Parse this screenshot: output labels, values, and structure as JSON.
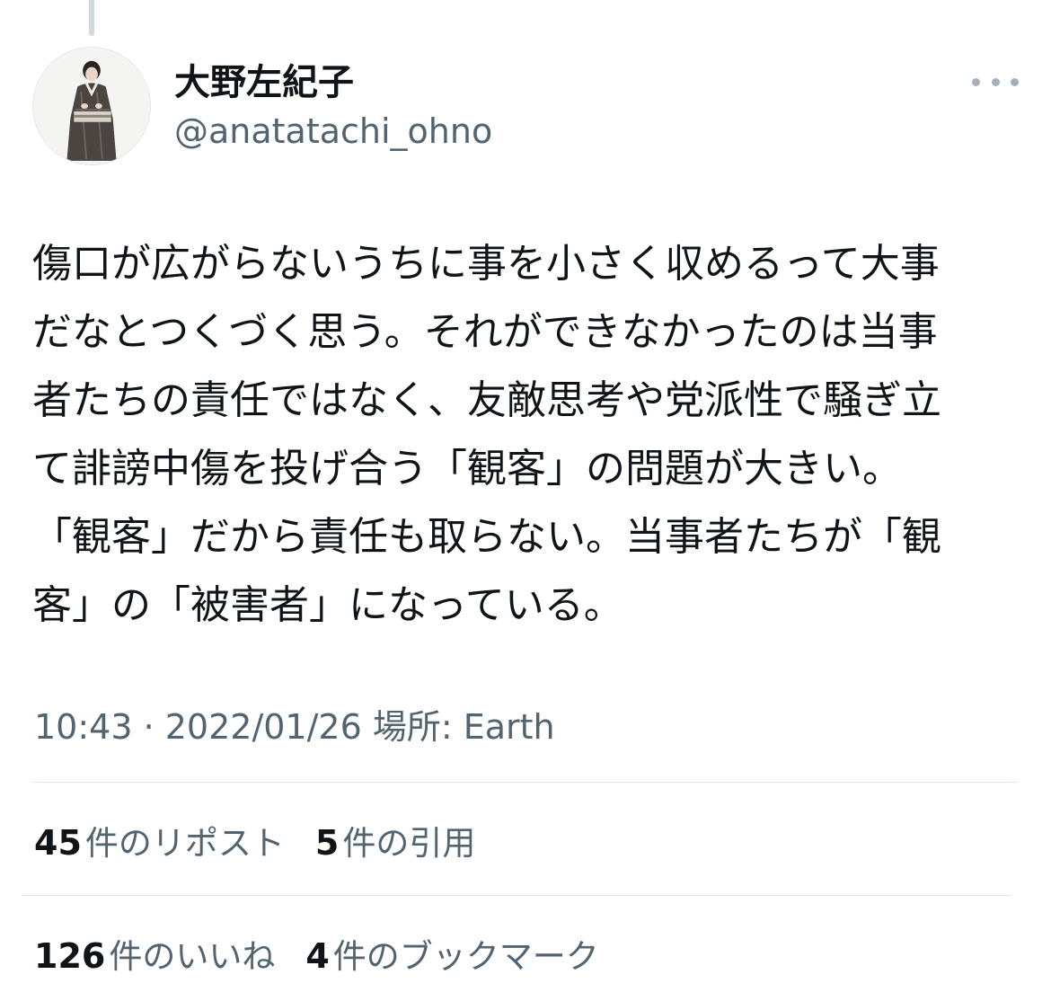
{
  "author": {
    "display_name": "大野左紀子",
    "handle": "@anatatachi_ohno"
  },
  "tweet": {
    "lines": [
      "傷口が広がらないうちに事を小さく収めるって大事",
      "だなとつくづく思う。それができなかったのは当事",
      "者たちの責任ではなく、友敵思考や党派性で騒ぎ立",
      "て誹謗中傷を投げ合う「観客」の問題が大きい。",
      "「観客」だから責任も取らない。当事者たちが「観",
      "客」の「被害者」になっている。"
    ],
    "meta": "10:43 · 2022/01/26 場所: Earth"
  },
  "stats": {
    "reposts": {
      "count": "45",
      "label": "件のリポスト"
    },
    "quotes": {
      "count": "5",
      "label": "件の引用"
    },
    "likes": {
      "count": "126",
      "label": "件のいいね"
    },
    "bookmarks": {
      "count": "4",
      "label": "件のブックマーク"
    }
  },
  "icons": {
    "more": "more-horizontal-icon"
  },
  "colors": {
    "text_primary": "#0f1419",
    "text_secondary": "#536471",
    "divider": "#e1e8ed",
    "thread_line": "#cfd9de"
  }
}
